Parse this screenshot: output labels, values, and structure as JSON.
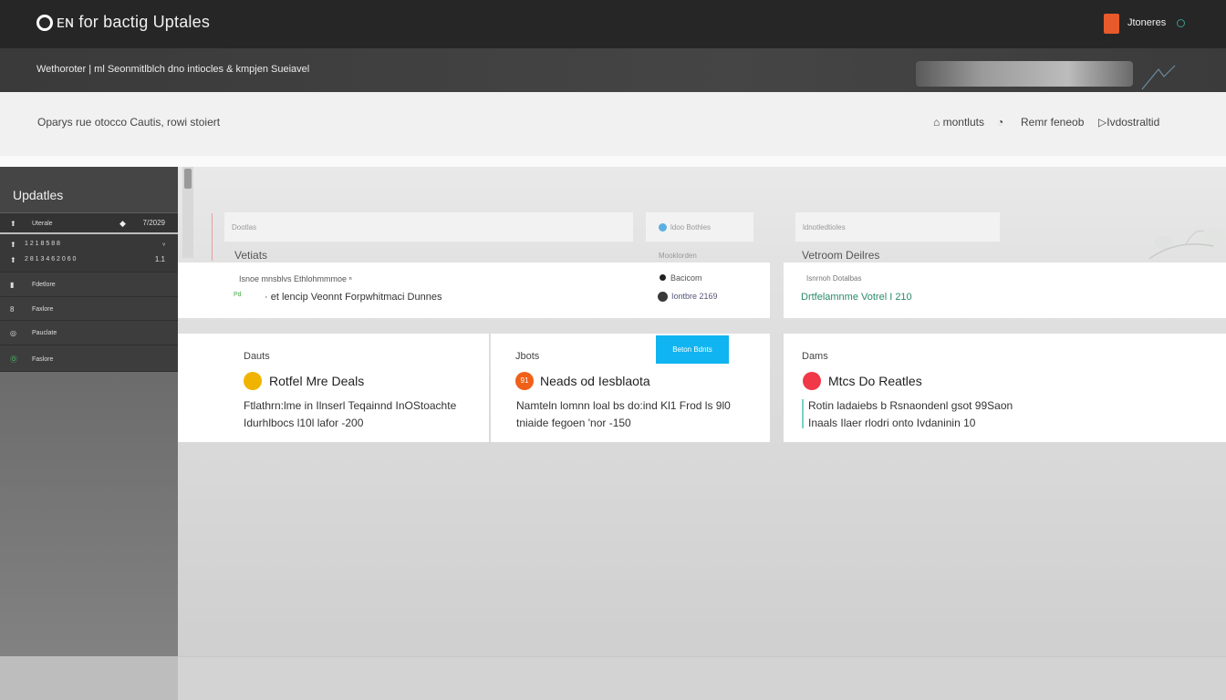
{
  "header": {
    "title": "ᴇɴ for bactig Uptales",
    "user_name": "Jtoneres"
  },
  "subheader": {
    "text": "Wethoroter  |  ml Seonmitlblch dno intiocles & kmpjen Sueiavel"
  },
  "filters": {
    "text": "Oparys rue  otocco   Cautis,  rowi stoiert",
    "links": [
      "montluts",
      "Remr feneob",
      "Ivdostraltid"
    ]
  },
  "sidebar": {
    "title": "Updatles",
    "items": [
      {
        "icon": "⬆",
        "label": "Uterale",
        "meta": "7/2029",
        "active": true
      },
      {
        "icon": "⬆",
        "label": "1  2 1 8 5 8 8",
        "meta": "ᵥ",
        "active": false
      },
      {
        "icon": "⬆",
        "label": "2  8 1 3 4 6 2 0 6 0",
        "meta": "1.1",
        "active": false
      },
      {
        "icon": "▮",
        "label": "Fdetlore",
        "meta": "",
        "active": false
      },
      {
        "icon": "8",
        "label": "Faxlore",
        "meta": "",
        "active": false
      },
      {
        "icon": "◎",
        "label": "Pauclate",
        "meta": "",
        "active": false
      },
      {
        "icon": "Ⓞ",
        "label": "Faslore",
        "meta": "",
        "active": false
      }
    ]
  },
  "panel_left": {
    "tag": "Dootlas",
    "heading": "Vetiats",
    "subtext": "Isnoe mnsblvs Ethlohmmmoe ⁿ",
    "row_num": "Pd",
    "row_text": "et lencip  Veonnt   Forpwhitmaci Dunnes"
  },
  "panel_mid": {
    "tag": "ldoo Bothles",
    "subhead": "Mooklorden",
    "item1": "Bacicom",
    "item2": "Iontbre  2169"
  },
  "panel_right": {
    "tag": "ldnotledtioles",
    "heading": "Vetroom Deilres",
    "subtext": "Isnrnoh Dotalbas",
    "row_text": "Drtfelamnme  Votrel  I 210"
  },
  "cards": [
    {
      "head": "Dauts",
      "title": "Rotfel Mre Deals",
      "line1": "Ftlathrn:lme in Ilnserl Teqainnd InOStoachte",
      "line2": "Idurhlbocs  l10l lafor  -200",
      "icon": "",
      "color": "#f0b400"
    },
    {
      "head": "Jbots",
      "title": "Neads od Iesblaota",
      "line1": "Namteln lomnn  loal bs do:ind  Kl1 Frod ls 9l0",
      "line2": "tniaide fegoen  'nor  -150",
      "icon": "91",
      "color": "#f06018"
    },
    {
      "head": "Dams",
      "title": "Mtcs Do Reatles",
      "line1": "Rotin ladaiebs b Rsnaondenl gsot 99Saon",
      "line2": "Inaals Ilaer  rlodri   onto  Ivdaninin 10",
      "icon": "",
      "color": "#f03848"
    }
  ],
  "button": {
    "label": "Beton Bdnts"
  },
  "colors": {
    "topbar": "#262626",
    "accent_blue": "#10b4f0",
    "badge_orange": "#e85a2c"
  }
}
